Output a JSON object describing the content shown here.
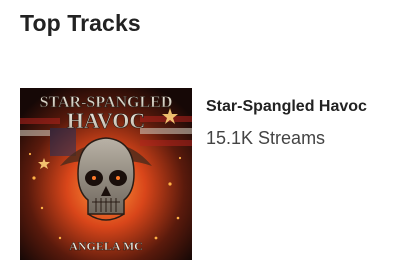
{
  "section": {
    "title": "Top Tracks"
  },
  "tracks": [
    {
      "title": "Star-Spangled Havoc",
      "streams": "15.1K Streams",
      "cover": {
        "art_title_top": "STAR-SPANGLED",
        "art_title_bottom": "HAVOC",
        "art_artist": "ANGELA MC"
      }
    }
  ],
  "colors": {
    "text_primary": "#222222",
    "text_secondary": "#444444",
    "cover_fire": "#e2561b",
    "cover_background": "#1a0c08"
  }
}
